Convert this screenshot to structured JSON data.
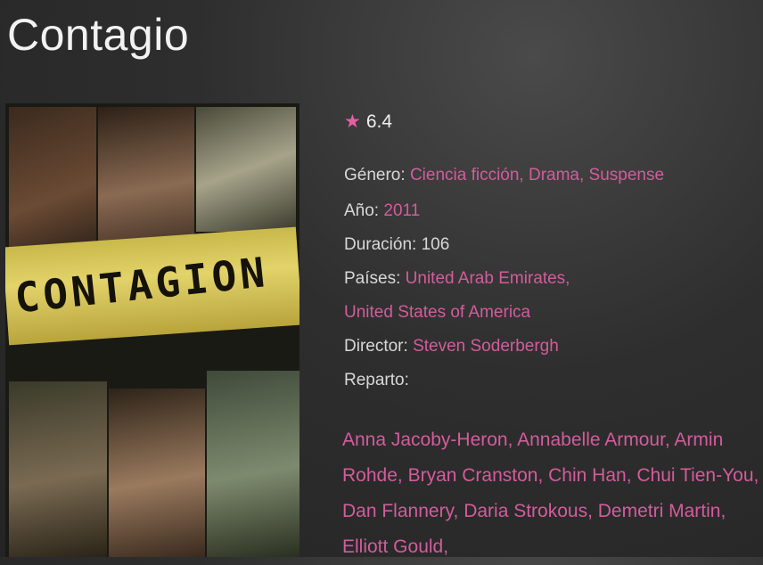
{
  "title": "Contagio",
  "rating": {
    "value": "6.4",
    "icon": "star-icon"
  },
  "poster": {
    "text": "CONTAGION"
  },
  "details": {
    "genre_label": "Género:",
    "genre_value": "Ciencia ficción, Drama, Suspense",
    "year_label": "Año:",
    "year_value": "2011",
    "duration_label": "Duración:",
    "duration_value": "106",
    "countries_label": "Países:",
    "countries_value_1": "United Arab Emirates,",
    "countries_value_2": "United States of America",
    "director_label": "Director:",
    "director_value": "Steven Soderbergh",
    "cast_label": "Reparto:"
  },
  "cast": [
    "Anna Jacoby-Heron",
    "Annabelle Armour",
    "Armin Rohde",
    "Bryan Cranston",
    "Chin Han",
    "Chui Tien-You",
    "Dan Flannery",
    "Daria Strokous",
    "Demetri Martin",
    "Elliott Gould"
  ],
  "colors": {
    "accent": "#d35c9c",
    "background": "#2e2e2e",
    "text": "#e6e6e6"
  }
}
